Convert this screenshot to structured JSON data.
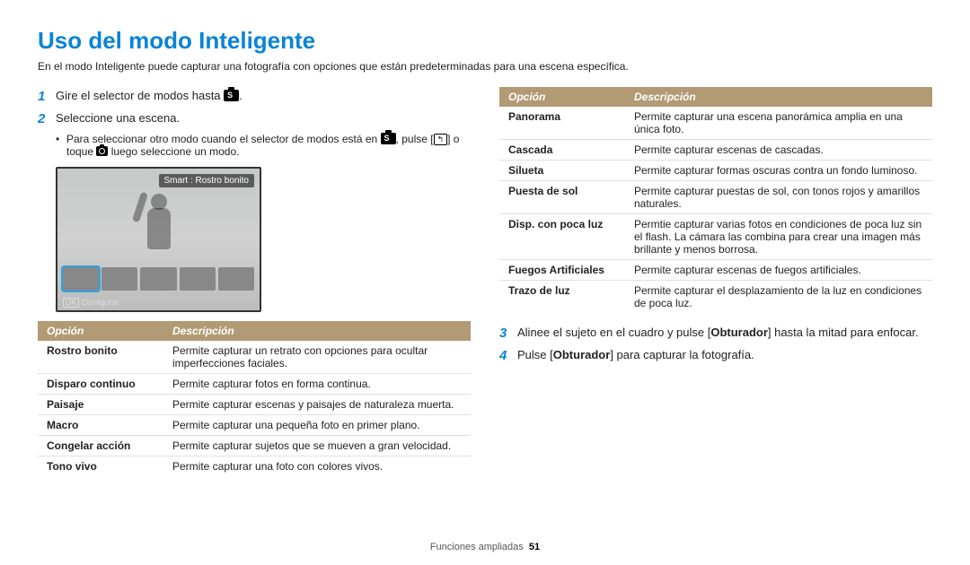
{
  "title": "Uso del modo Inteligente",
  "intro": "En el modo Inteligente puede capturar una fotografía con opciones que están predeterminadas para una escena específica.",
  "steps": {
    "s1": "Gire el selector de modos hasta",
    "s1b": ".",
    "s2": "Seleccione una escena.",
    "s2_sub_a": "Para seleccionar otro modo cuando el selector de modos está en",
    "s2_sub_b": ", pulse",
    "s2_sub_c": "[",
    "s2_sub_back": "↰",
    "s2_sub_d": "] o toque",
    "s2_sub_e": "luego seleccione un modo.",
    "s3a": "Alinee el sujeto en el cuadro y pulse [",
    "s3b": "Obturador",
    "s3c": "] hasta la mitad para enfocar.",
    "s4a": "Pulse [",
    "s4b": "Obturador",
    "s4c": "] para capturar la fotografía."
  },
  "preview": {
    "label": "Smart : Rostro bonito",
    "ok": "OK",
    "config": "Configurar"
  },
  "headers": {
    "opt": "Opción",
    "desc": "Descripción"
  },
  "left_table": [
    {
      "o": "Rostro bonito",
      "d": "Permite capturar un retrato con opciones para ocultar imperfecciones faciales."
    },
    {
      "o": "Disparo continuo",
      "d": "Permite capturar fotos en forma continua."
    },
    {
      "o": "Paisaje",
      "d": "Permite capturar escenas y paisajes de naturaleza muerta."
    },
    {
      "o": "Macro",
      "d": "Permite capturar una pequeña foto en primer plano."
    },
    {
      "o": "Congelar acción",
      "d": "Permite capturar sujetos que se mueven a gran velocidad."
    },
    {
      "o": "Tono vivo",
      "d": "Permite capturar una foto con colores vivos."
    }
  ],
  "right_table": [
    {
      "o": "Panorama",
      "d": "Permite capturar una escena panorámica amplia en una única foto."
    },
    {
      "o": "Cascada",
      "d": "Permite capturar escenas de cascadas."
    },
    {
      "o": "Silueta",
      "d": "Permite capturar formas oscuras contra un fondo luminoso."
    },
    {
      "o": "Puesta de sol",
      "d": "Permite capturar puestas de sol, con tonos rojos y amarillos naturales."
    },
    {
      "o": "Disp. con poca luz",
      "d": "Permtie capturar varias fotos en condiciones de poca luz sin el flash. La cámara las combina para crear una imagen más brillante y menos borrosa."
    },
    {
      "o": "Fuegos Artificiales",
      "d": "Permite capturar escenas de fuegos artificiales."
    },
    {
      "o": "Trazo de luz",
      "d": "Permite capturar el desplazamiento de la luz en condiciones de poca luz."
    }
  ],
  "footer": {
    "section": "Funciones ampliadas",
    "page": "51"
  }
}
